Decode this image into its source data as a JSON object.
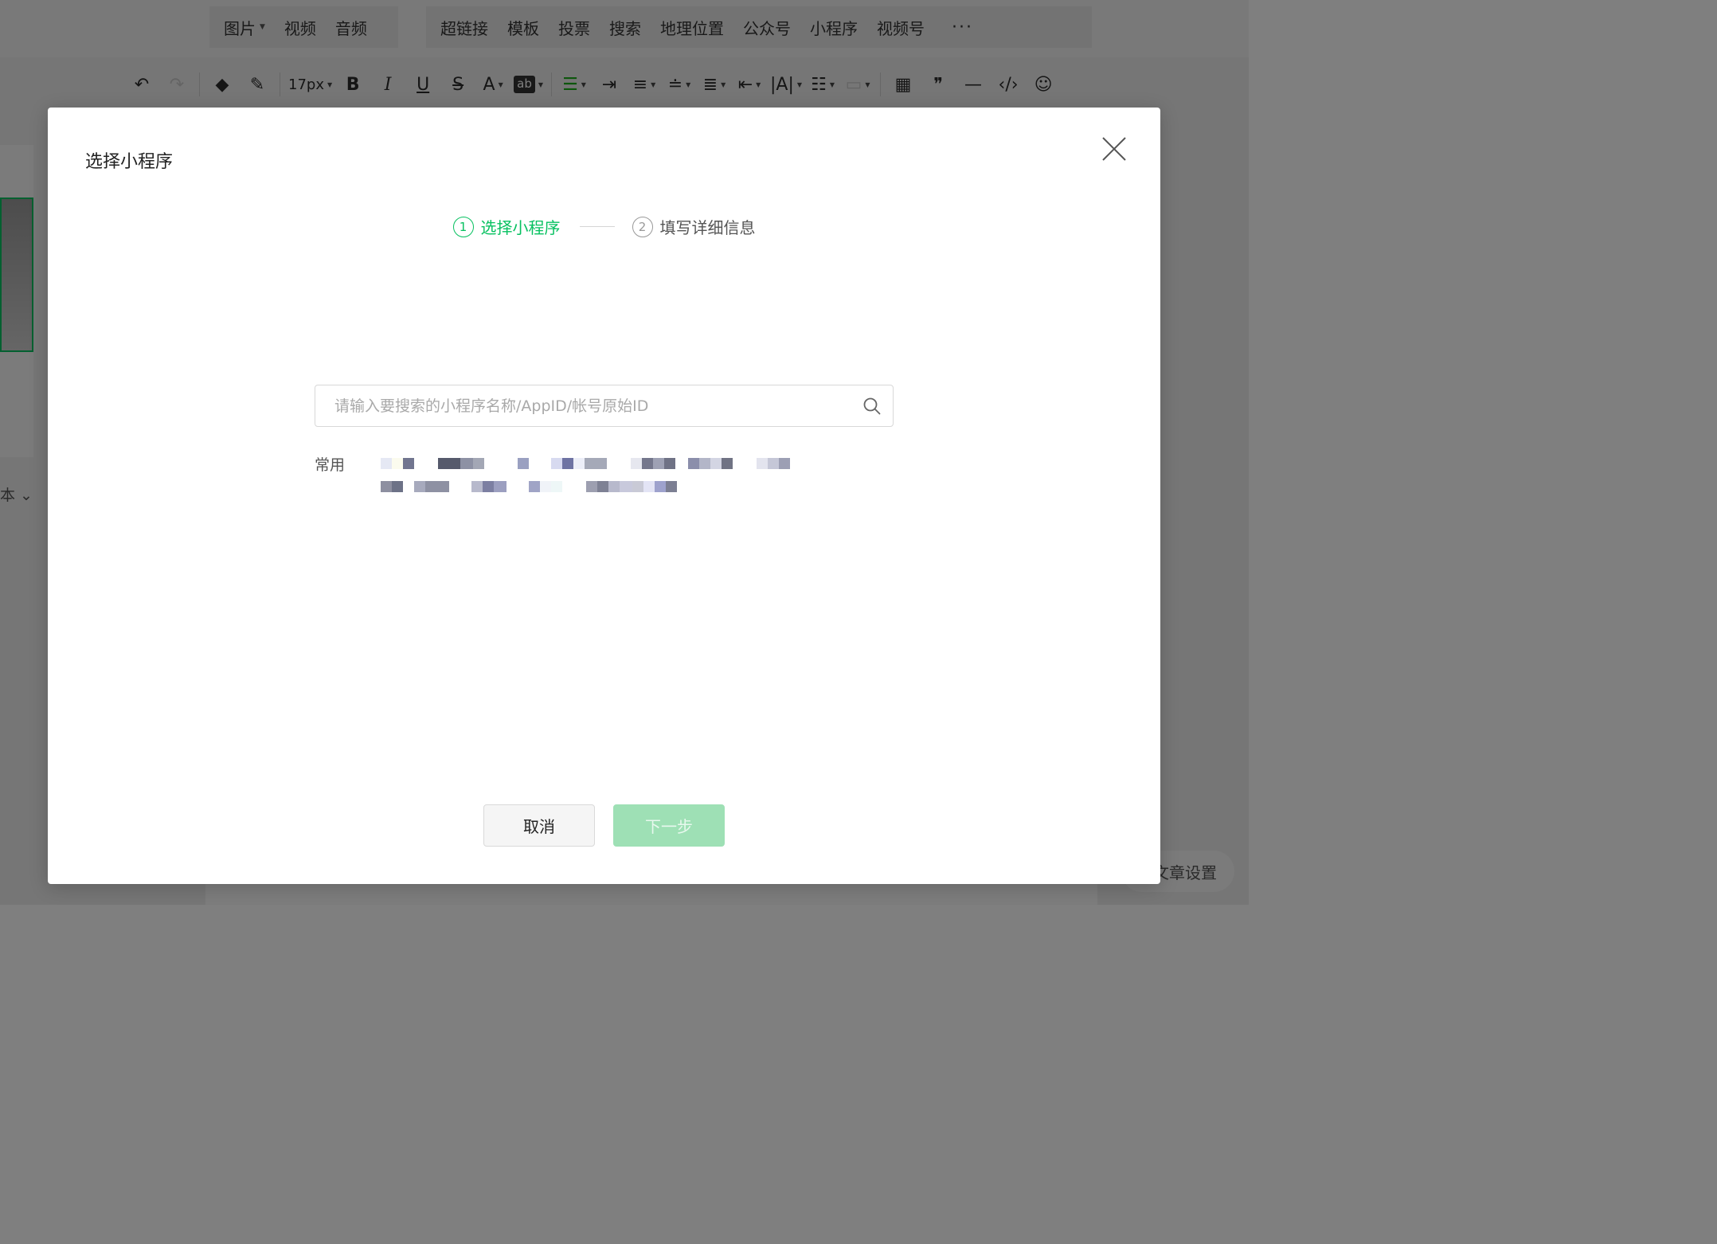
{
  "insert_bar": {
    "group1": [
      {
        "label": "图片",
        "has_caret": true
      },
      {
        "label": "视频"
      },
      {
        "label": "音频"
      }
    ],
    "group2": [
      {
        "label": "超链接"
      },
      {
        "label": "模板"
      },
      {
        "label": "投票"
      },
      {
        "label": "搜索"
      },
      {
        "label": "地理位置"
      },
      {
        "label": "公众号"
      },
      {
        "label": "小程序"
      },
      {
        "label": "视频号"
      }
    ],
    "more_label": "···"
  },
  "toolbar": {
    "undo": "↶",
    "redo": "↷",
    "eraser": "◆",
    "format_brush": "✎",
    "font_size": "17px",
    "bold": "B",
    "italic": "I",
    "underline": "U",
    "strike": "S",
    "font_color": "A",
    "bg_color": "ab",
    "align": "☰",
    "indent": "⇥",
    "align_center": "≡",
    "line_height": "≐",
    "para_spacing": "≣",
    "indent_list": "⇤",
    "letter_spacing": "|A|",
    "list": "☷",
    "table": "▦",
    "quote": "❞",
    "hr": "—",
    "code": "‹/›",
    "emoji": "☺"
  },
  "left_text": "本 ⌄",
  "article_settings": "文章设置",
  "modal": {
    "title": "选择小程序",
    "steps": [
      {
        "number": "1",
        "label": "选择小程序",
        "state": "active"
      },
      {
        "number": "2",
        "label": "填写详细信息",
        "state": "inactive"
      }
    ],
    "search": {
      "placeholder": "请输入要搜索的小程序名称/AppID/帐号原始ID",
      "value": ""
    },
    "common_label": "常用",
    "cancel_label": "取消",
    "next_label": "下一步"
  },
  "colors": {
    "accent": "#07c160",
    "next_disabled": "#9ee0b5"
  }
}
